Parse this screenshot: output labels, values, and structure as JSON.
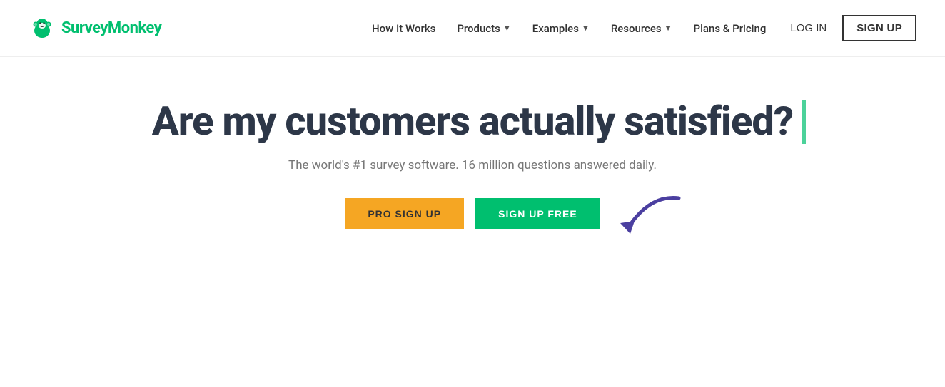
{
  "brand": {
    "name": "SurveyMonkey",
    "trademark": "®"
  },
  "nav": {
    "items": [
      {
        "id": "how-it-works",
        "label": "How It Works",
        "hasDropdown": false
      },
      {
        "id": "products",
        "label": "Products",
        "hasDropdown": true
      },
      {
        "id": "examples",
        "label": "Examples",
        "hasDropdown": true
      },
      {
        "id": "resources",
        "label": "Resources",
        "hasDropdown": true
      },
      {
        "id": "plans-pricing",
        "label": "Plans & Pricing",
        "hasDropdown": false
      }
    ],
    "login_label": "LOG IN",
    "signup_label": "SIGN UP"
  },
  "hero": {
    "title": "Are my customers actually satisfied?",
    "subtitle": "The world's #1 survey software. 16 million questions answered daily.",
    "btn_pro": "PRO SIGN UP",
    "btn_free": "SIGN UP FREE"
  }
}
